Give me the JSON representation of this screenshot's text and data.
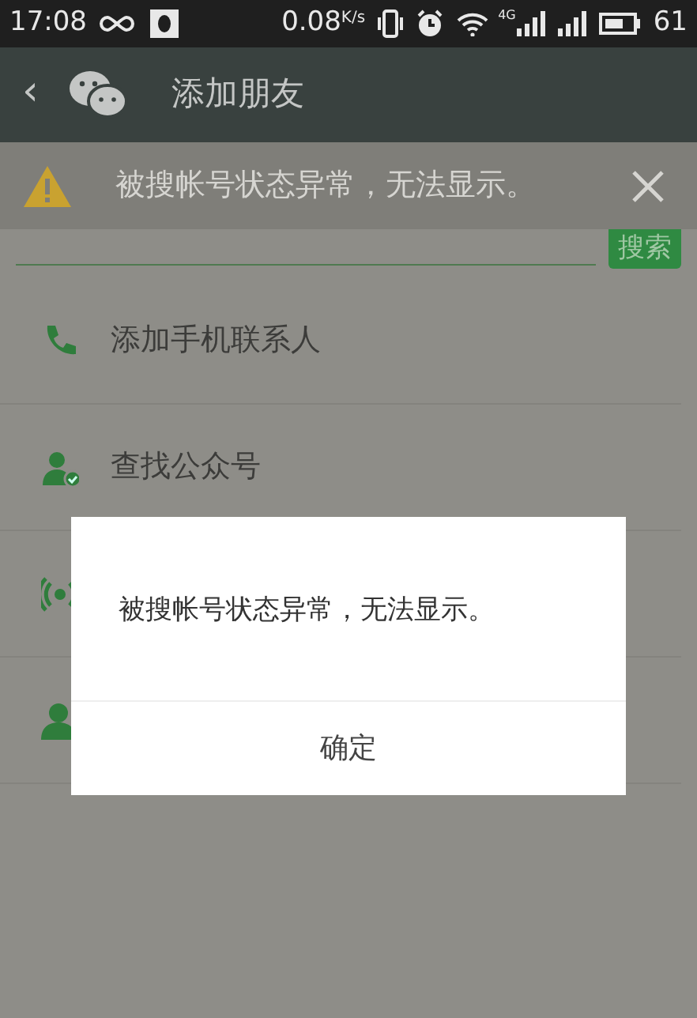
{
  "status_bar": {
    "time": "17:08",
    "speed": "0.08$^{K/s}$",
    "network": "4G",
    "battery": "61"
  },
  "header": {
    "back": "‹",
    "title": "添加朋友"
  },
  "banner": {
    "message": "被搜帐号状态异常，无法显示。"
  },
  "search": {
    "button": "搜索"
  },
  "list": [
    {
      "kind": "phone",
      "label": "添加手机联系人"
    },
    {
      "kind": "official",
      "label": "查找公众号"
    },
    {
      "kind": "radar"
    },
    {
      "kind": "person"
    }
  ],
  "dialog": {
    "message": "被搜帐号状态异常，无法显示。",
    "button": "确定"
  }
}
